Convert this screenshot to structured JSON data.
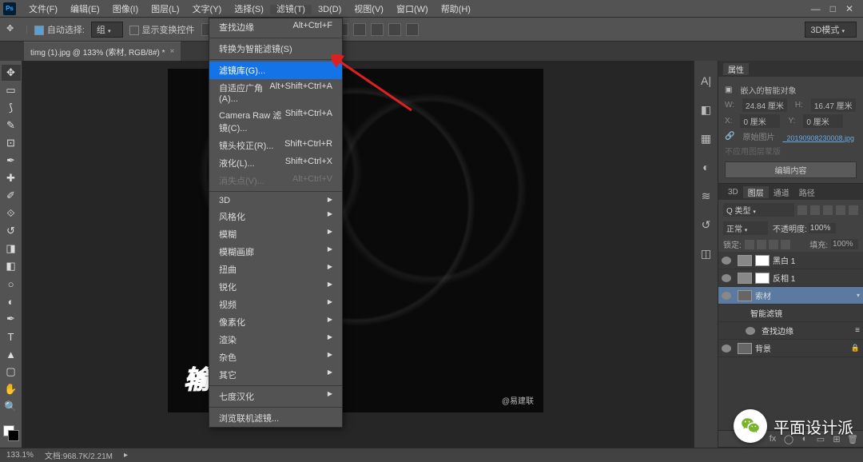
{
  "menubar": {
    "items": [
      "文件(F)",
      "编辑(E)",
      "图像(I)",
      "图层(L)",
      "文字(Y)",
      "选择(S)",
      "滤镜(T)",
      "3D(D)",
      "视图(V)",
      "窗口(W)",
      "帮助(H)"
    ],
    "active_index": 6
  },
  "optionsbar": {
    "auto_select_label": "自动选择:",
    "auto_select_value": "组",
    "transform_label": "显示变换控件"
  },
  "doc_tab": {
    "title": "timg (1).jpg @ 133% (索材, RGB/8#) *"
  },
  "dropdown": {
    "items": [
      {
        "label": "查找边缘",
        "shortcut": "Alt+Ctrl+F"
      },
      {
        "sep": true
      },
      {
        "label": "转换为智能滤镜(S)"
      },
      {
        "sep": true
      },
      {
        "label": "滤镜库(G)...",
        "highlighted": true
      },
      {
        "label": "自适应广角(A)...",
        "shortcut": "Alt+Shift+Ctrl+A"
      },
      {
        "label": "Camera Raw 滤镜(C)...",
        "shortcut": "Shift+Ctrl+A"
      },
      {
        "label": "镜头校正(R)...",
        "shortcut": "Shift+Ctrl+R"
      },
      {
        "label": "液化(L)...",
        "shortcut": "Shift+Ctrl+X"
      },
      {
        "label": "消失点(V)...",
        "shortcut": "Alt+Ctrl+V",
        "disabled": true
      },
      {
        "sep": true
      },
      {
        "label": "3D",
        "sub": true
      },
      {
        "label": "风格化",
        "sub": true
      },
      {
        "label": "模糊",
        "sub": true
      },
      {
        "label": "模糊画廊",
        "sub": true
      },
      {
        "label": "扭曲",
        "sub": true
      },
      {
        "label": "锐化",
        "sub": true
      },
      {
        "label": "视频",
        "sub": true
      },
      {
        "label": "像素化",
        "sub": true
      },
      {
        "label": "渲染",
        "sub": true
      },
      {
        "label": "杂色",
        "sub": true
      },
      {
        "label": "其它",
        "sub": true
      },
      {
        "sep": true
      },
      {
        "label": "七度汉化",
        "sub": true
      },
      {
        "sep": true
      },
      {
        "label": "浏览联机滤镜..."
      }
    ]
  },
  "properties": {
    "tab": "属性",
    "title": "嵌入的智能对象",
    "w_label": "W:",
    "w_value": "24.84 厘米",
    "h_label": "H:",
    "h_value": "16.47 厘米",
    "x_label": "X:",
    "x_value": "0 厘米",
    "y_label": "Y:",
    "y_value": "0 厘米",
    "src_label": "原始图片",
    "src_value": "_20190908230008.jpg",
    "not_applied": "不应用图层蒙版",
    "edit_btn": "编辑内容"
  },
  "layers_panel": {
    "tabs": [
      "3D",
      "图层",
      "通道",
      "路径"
    ],
    "active_tab": 1,
    "filter_label": "Q 类型",
    "blend_mode": "正常",
    "opacity_label": "不透明度:",
    "opacity_value": "100%",
    "lock_label": "锁定:",
    "fill_label": "填充:",
    "fill_value": "100%",
    "layers": [
      {
        "eye": true,
        "thumb": "white",
        "name": "黑白 1",
        "adjust": true
      },
      {
        "eye": true,
        "thumb": "white",
        "name": "反相 1",
        "adjust": true
      },
      {
        "eye": true,
        "thumb": "img",
        "name": "索材",
        "selected": true,
        "smart": true,
        "indent": 0
      },
      {
        "eye": false,
        "name": "智能滤镜",
        "indent": 1,
        "filters_label": true
      },
      {
        "eye": true,
        "name": "查找边缘",
        "indent": 2,
        "fx": true
      },
      {
        "eye": true,
        "thumb": "img",
        "name": "背景",
        "locked": true
      }
    ]
  },
  "canvas": {
    "overlay_text": "输，一起扛",
    "watermark": "@易建联"
  },
  "statusbar": {
    "zoom": "133.1%",
    "docinfo": "文档:968.7K/2.21M"
  },
  "wechat": {
    "text": "平面设计派"
  }
}
